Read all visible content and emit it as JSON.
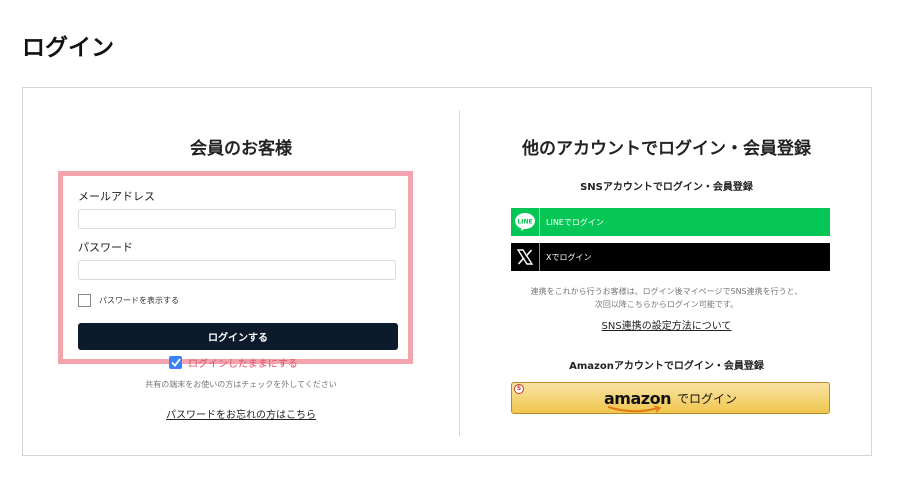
{
  "page": {
    "title": "ログイン"
  },
  "member": {
    "title": "会員のお客様",
    "email_label": "メールアドレス",
    "email_value": "",
    "password_label": "パスワード",
    "password_value": "",
    "show_password_label": "パスワードを表示する",
    "login_button": "ログインする",
    "stay_logged_in": "ログインしたままにする",
    "shared_device_note": "共有の端末をお使いの方はチェックを外してください",
    "forgot_password": "パスワードをお忘れの方はこちら"
  },
  "other": {
    "title": "他のアカウントでログイン・会員登録",
    "sns_heading": "SNSアカウントでログイン・会員登録",
    "line_icon_text": "LINE",
    "line_button": "LINEでログイン",
    "x_button": "Xでログイン",
    "sns_note_1": "連携をこれから行うお客様は、ログイン後マイページでSNS連携を行うと、",
    "sns_note_2": "次回以降こちらからログイン可能です。",
    "sns_setup_link": "SNS連携の設定方法について",
    "amazon_heading": "Amazonアカウントでログイン・会員登録",
    "amazon_badge": "S",
    "amazon_logo": "amazon",
    "amazon_button": "でログイン"
  },
  "colors": {
    "form_highlight": "#f4a2ad",
    "login_button": "#0b1b2b",
    "line_green": "#06c755",
    "x_black": "#000000",
    "checkbox_blue": "#3b82f6",
    "stay_text": "#e0516b",
    "amazon_gold": "#f1c64e"
  },
  "icons": {
    "line": "line-logo-icon",
    "x": "x-logo-icon",
    "check": "checkmark-icon",
    "amazon_smile": "amazon-smile-icon"
  }
}
